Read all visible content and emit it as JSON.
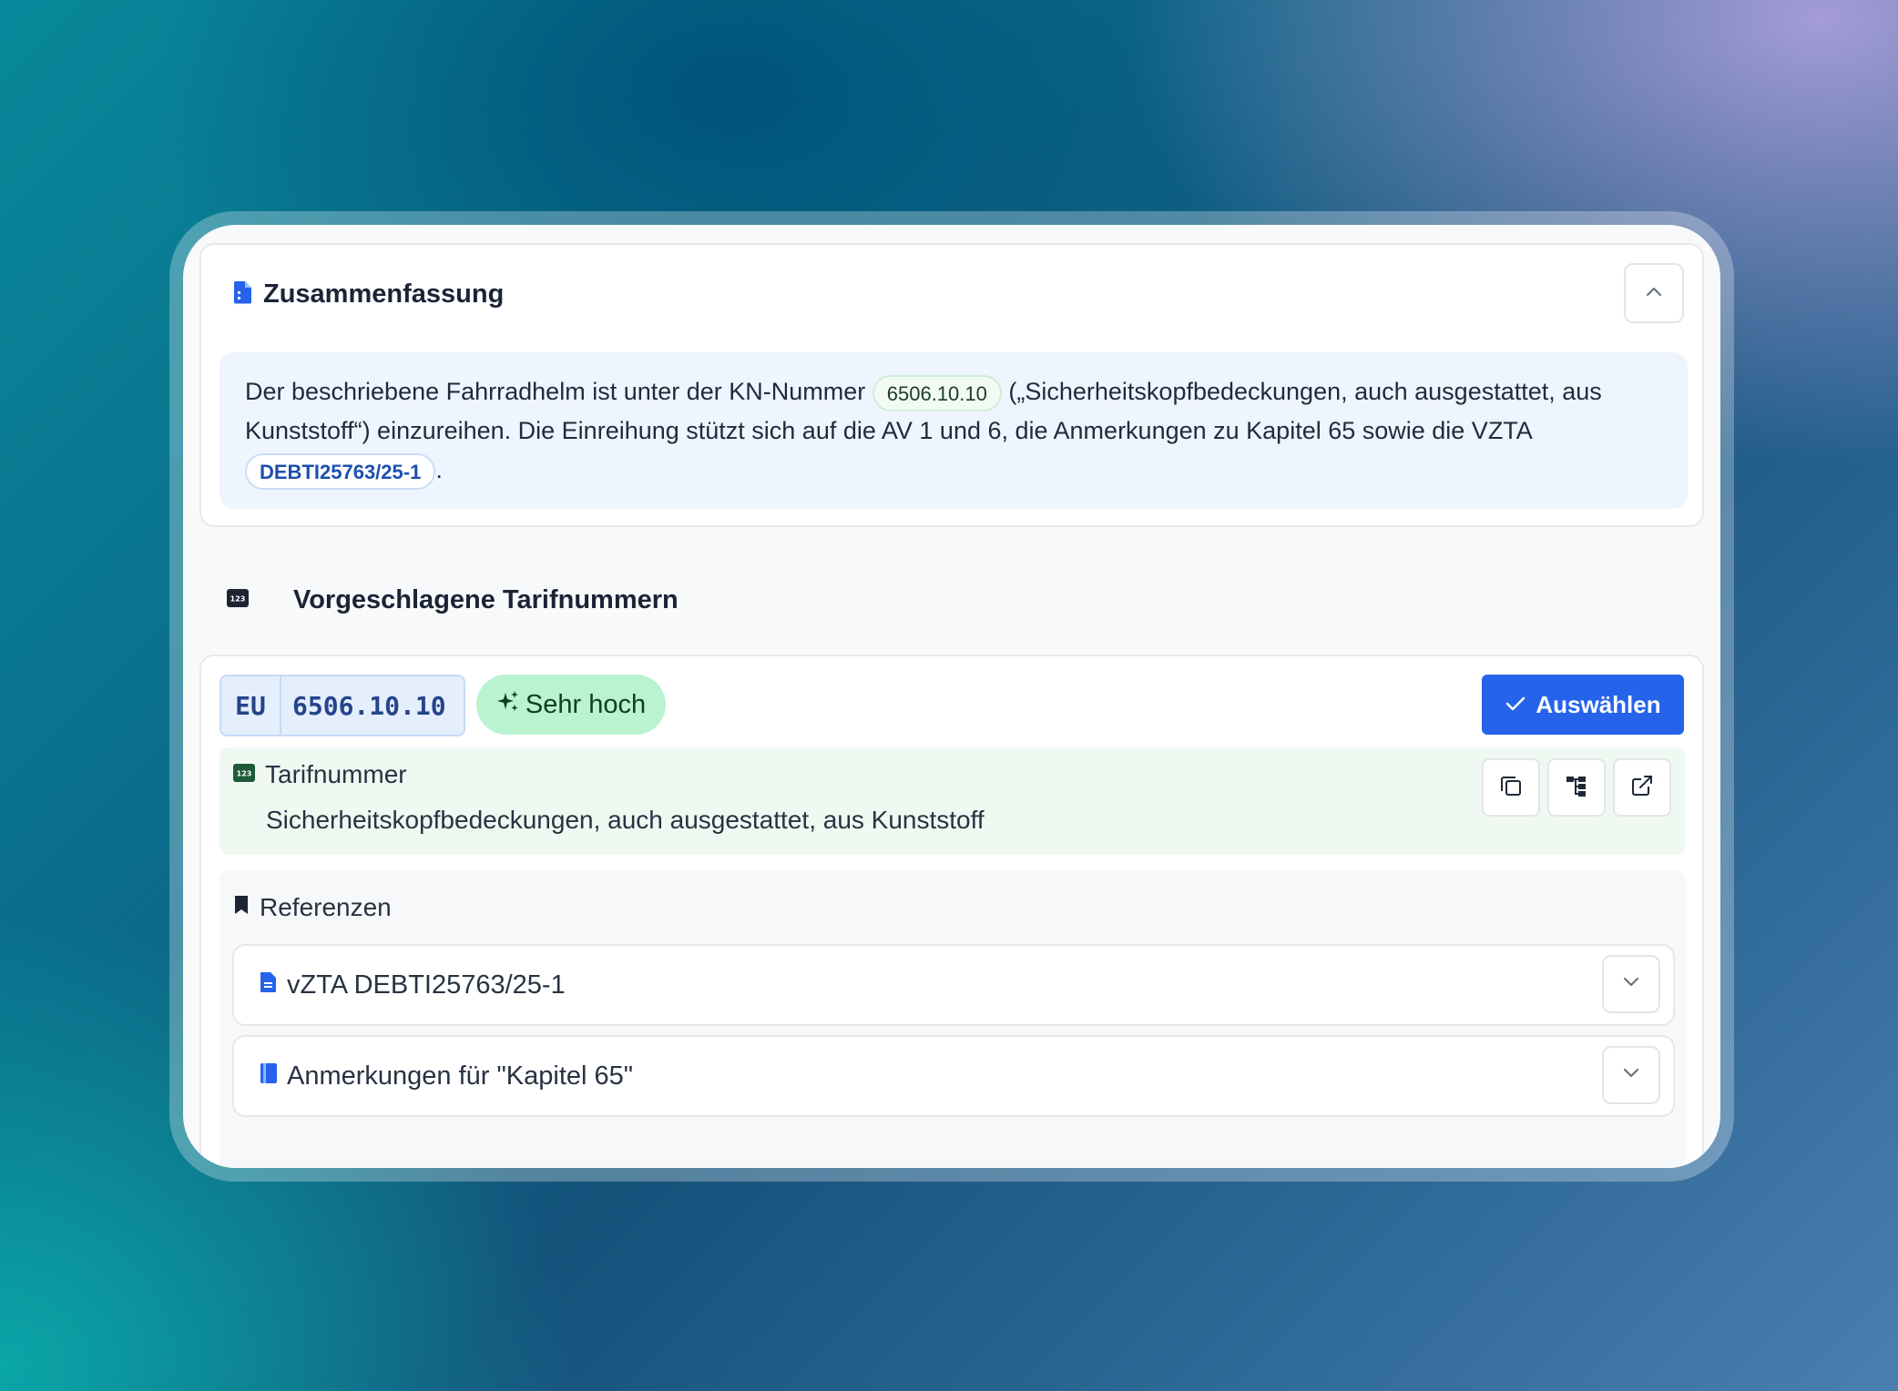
{
  "summary": {
    "title": "Zusammenfassung",
    "text_1": "Der beschriebene Fahrradhelm ist unter der KN-Nummer ",
    "kn_chip": "6506.10.10",
    "text_2": " („Sicherheitskopfbedeckungen, auch ausgestattet, aus Kunststoff“) einzureihen. Die Einreihung stützt sich auf die AV 1 und 6, die Anmerkungen zu Kapitel 65 sowie die VZTA ",
    "vzta_chip": "DEBTI25763/25-1",
    "text_3": "."
  },
  "suggestions": {
    "title": "Vorgeschlagene Tarifnummern",
    "items": [
      {
        "region": "EU",
        "code": "6506.10.10",
        "confidence": "Sehr hoch",
        "select_label": "Auswählen",
        "tariff_label": "Tarifnummer",
        "tariff_description": "Sicherheitskopfbedeckungen, auch ausgestattet, aus Kunststoff",
        "references_title": "Referenzen",
        "references": [
          {
            "label": "vZTA DEBTI25763/25-1",
            "icon": "document-icon"
          },
          {
            "label": "Anmerkungen für \"Kapitel 65\"",
            "icon": "book-icon"
          }
        ]
      }
    ]
  },
  "colors": {
    "primary": "#2563eb",
    "confidence_bg": "#b9f3cf",
    "summary_bg": "#eef5fe",
    "tariff_bg": "#eff9f2"
  }
}
